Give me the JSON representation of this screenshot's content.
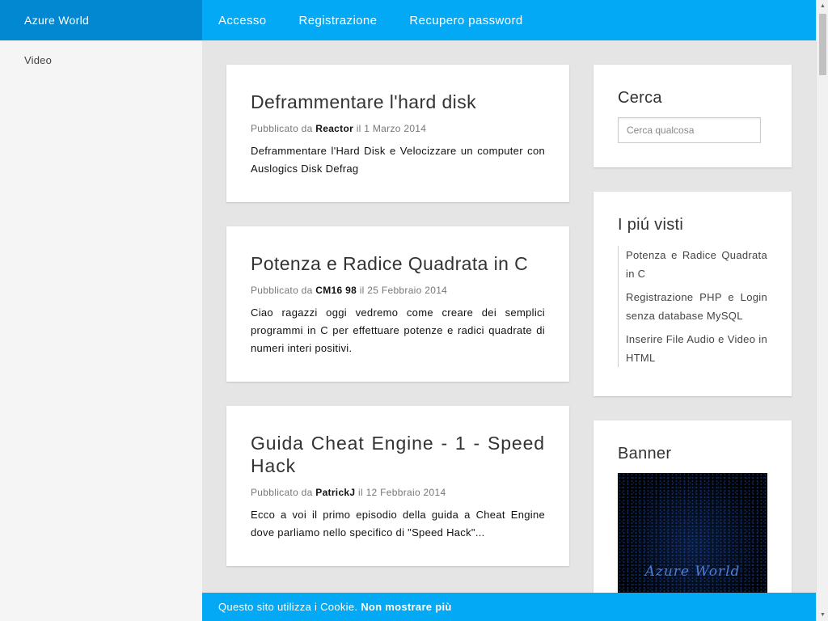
{
  "brand": "Azure World",
  "sidebar": {
    "items": [
      {
        "label": "Video"
      }
    ]
  },
  "topnav": {
    "items": [
      {
        "label": "Accesso"
      },
      {
        "label": "Registrazione"
      },
      {
        "label": "Recupero password"
      }
    ]
  },
  "posts": [
    {
      "title": "Deframmentare l'hard disk",
      "meta_prefix": "Pubblicato da",
      "author": "Reactor",
      "date": "il 1 Marzo 2014",
      "excerpt": "Deframmentare l'Hard Disk e Velocizzare un computer con Auslogics Disk Defrag"
    },
    {
      "title": "Potenza e Radice Quadrata in C",
      "meta_prefix": "Pubblicato da",
      "author": "CM16 98",
      "date": "il 25 Febbraio 2014",
      "excerpt": "Ciao ragazzi oggi vedremo come creare dei semplici programmi in C per effettuare potenze e radici quadrate di numeri interi positivi."
    },
    {
      "title": "Guida Cheat Engine - 1 - Speed Hack",
      "meta_prefix": "Pubblicato da",
      "author": "PatrickJ",
      "date": "il 12 Febbraio 2014",
      "excerpt": "Ecco a voi il primo episodio della guida a Cheat Engine dove parliamo nello specifico di \"Speed Hack\"..."
    }
  ],
  "search": {
    "title": "Cerca",
    "placeholder": "Cerca qualcosa"
  },
  "popular": {
    "title": "I piú visti",
    "items": [
      "Potenza e Radice Quadrata in C",
      "Registrazione PHP e Login senza database MySQL",
      "Inserire File Audio e Video in HTML"
    ]
  },
  "banner": {
    "title": "Banner",
    "logo_text": "Azure World"
  },
  "cookie": {
    "text": "Questo sito utilizza i Cookie.",
    "action": "Non mostrare più"
  },
  "colors": {
    "nav_blue": "#03a9f4",
    "brand_blue": "#0288d1",
    "background": "#e5e5e5"
  }
}
